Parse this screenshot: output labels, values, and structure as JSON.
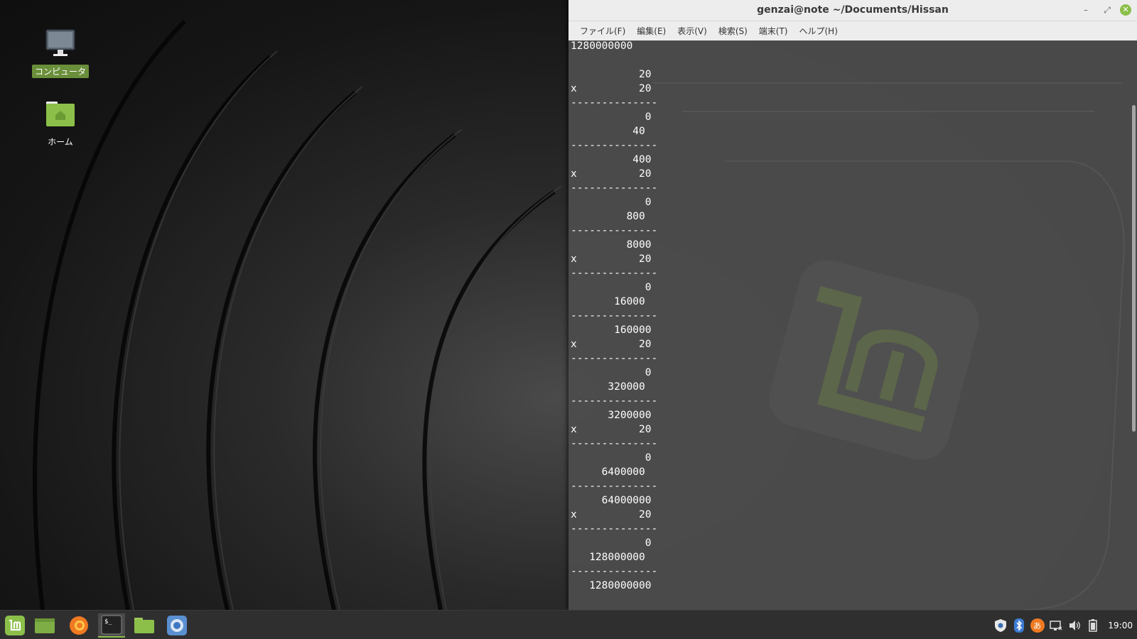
{
  "desktop": {
    "icons": [
      {
        "label": "コンピュータ"
      },
      {
        "label": "ホーム"
      }
    ]
  },
  "terminal": {
    "title": "genzai@note ~/Documents/Hissan",
    "menus": [
      "ファイル(F)",
      "編集(E)",
      "表示(V)",
      "検索(S)",
      "端末(T)",
      "ヘルプ(H)"
    ],
    "output": "1280000000\n\n           20\nx          20\n--------------\n            0\n          40\n--------------\n          400\nx          20\n--------------\n            0\n         800\n--------------\n         8000\nx          20\n--------------\n            0\n       16000\n--------------\n       160000\nx          20\n--------------\n            0\n      320000\n--------------\n      3200000\nx          20\n--------------\n            0\n     6400000\n--------------\n     64000000\nx          20\n--------------\n            0\n   128000000\n--------------\n   1280000000"
  },
  "taskbar": {
    "clock": "19:00",
    "accent_color": "#8cbf4a"
  }
}
